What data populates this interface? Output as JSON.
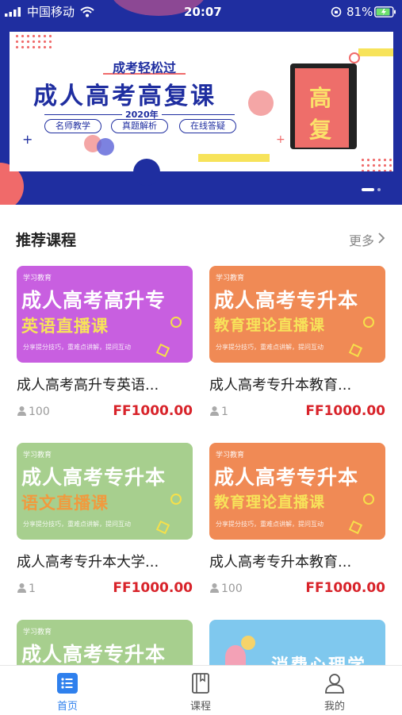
{
  "status": {
    "carrier": "中国移动",
    "time": "20:07",
    "battery": "81%"
  },
  "banner": {
    "kicker": "成考轻松过",
    "title": "成人高考高复课",
    "year": "2020年",
    "chips": [
      "名师教学",
      "真题解析",
      "在线答疑"
    ],
    "book_text": [
      "高",
      "复"
    ],
    "page_indicator": {
      "total": 2,
      "active": 0
    }
  },
  "section": {
    "title": "推荐课程",
    "more": "更多"
  },
  "courses": [
    {
      "poster": {
        "logo": "学习教育",
        "line1": "成人高考高升专",
        "line2": "英语直播课",
        "sub": "分享提分技巧，重难点讲解，提问互动",
        "bg": "#c85fe0",
        "line2_color": "#f7e35a"
      },
      "title": "成人高考高升专英语...",
      "learners": "100",
      "price": "FF1000.00"
    },
    {
      "poster": {
        "logo": "学习教育",
        "line1": "成人高考专升本",
        "line2": "教育理论直播课",
        "sub": "分享提分技巧，重难点讲解，提问互动",
        "bg": "#f08a55",
        "line2_color": "#f7e35a"
      },
      "title": "成人高考专升本教育...",
      "learners": "1",
      "price": "FF1000.00"
    },
    {
      "poster": {
        "logo": "学习教育",
        "line1": "成人高考专升本",
        "line2": "语文直播课",
        "sub": "分享提分技巧，重难点讲解，提问互动",
        "bg": "#a7cf8e",
        "line2_color": "#f19a3e"
      },
      "title": "成人高考专升本大学...",
      "learners": "1",
      "price": "FF1000.00"
    },
    {
      "poster": {
        "logo": "学习教育",
        "line1": "成人高考专升本",
        "line2": "教育理论直播课",
        "sub": "分享提分技巧，重难点讲解，提问互动",
        "bg": "#f08a55",
        "line2_color": "#f7e35a"
      },
      "title": "成人高考专升本教育...",
      "learners": "100",
      "price": "FF1000.00"
    },
    {
      "poster": {
        "logo": "学习教育",
        "line1": "成人高考专升本",
        "bg": "#a7cf8e"
      }
    },
    {
      "poster": {
        "line1": "消费心理学",
        "bg": "#7fc8ee"
      }
    }
  ],
  "tabs": [
    {
      "label": "首页",
      "icon": "home-list-icon",
      "active": true
    },
    {
      "label": "课程",
      "icon": "book-icon",
      "active": false
    },
    {
      "label": "我的",
      "icon": "profile-icon",
      "active": false
    }
  ],
  "colors": {
    "accent": "#2f80ed",
    "price": "#d8232a",
    "banner_blue": "#1f2ea0"
  }
}
